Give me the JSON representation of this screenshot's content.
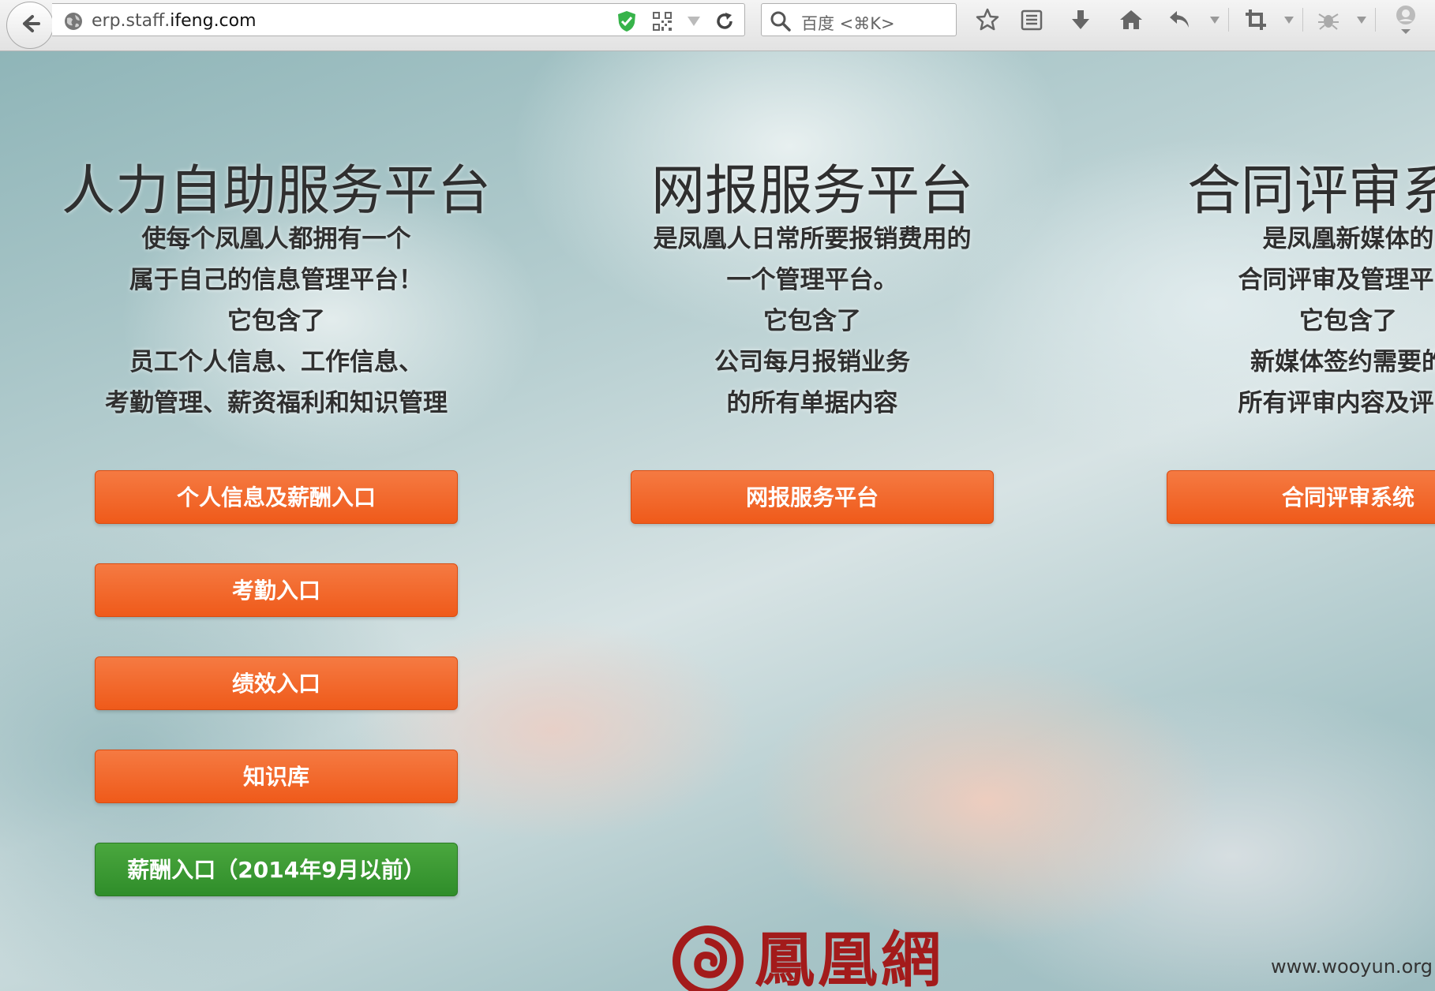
{
  "browser": {
    "url_prefix": "erp.staff.",
    "url_domain": "ifeng.com",
    "search_placeholder": "百度 <⌘K>",
    "icons": [
      "back-arrow-icon",
      "globe-icon",
      "shield-check-icon",
      "qr-code-icon",
      "dropdown-icon",
      "reload-icon",
      "search-icon",
      "star-icon",
      "reading-list-icon",
      "download-icon",
      "home-icon",
      "undo-icon",
      "crop-icon",
      "bug-icon",
      "user-icon"
    ]
  },
  "columns": [
    {
      "title": "人力自助服务平台",
      "description": [
        "使每个凤凰人都拥有一个",
        "属于自己的信息管理平台！",
        "它包含了",
        "员工个人信息、工作信息、",
        "考勤管理、薪资福利和知识管理"
      ],
      "buttons": [
        {
          "label": "个人信息及薪酬入口",
          "style": "orange"
        },
        {
          "label": "考勤入口",
          "style": "orange"
        },
        {
          "label": "绩效入口",
          "style": "orange"
        },
        {
          "label": "知识库",
          "style": "orange"
        },
        {
          "label": "薪酬入口（2014年9月以前）",
          "style": "green"
        }
      ]
    },
    {
      "title": "网报服务平台",
      "description": [
        "是凤凰人日常所要报销费用的",
        "一个管理平台。",
        "它包含了",
        "公司每月报销业务",
        "的所有单据内容"
      ],
      "buttons": [
        {
          "label": "网报服务平台",
          "style": "orange"
        }
      ]
    },
    {
      "title": "合同评审系统",
      "description": [
        "是凤凰新媒体的",
        "合同评审及管理平台",
        "它包含了",
        "新媒体签约需要的",
        "所有评审内容及评审"
      ],
      "buttons": [
        {
          "label": "合同评审系统",
          "style": "orange"
        }
      ]
    }
  ],
  "footer": {
    "logo_text": "鳳凰網",
    "watermark": "www.wooyun.org"
  },
  "colors": {
    "orange": "#ef5a1a",
    "green": "#2f8d2a",
    "logo_red": "#a31b1b"
  }
}
